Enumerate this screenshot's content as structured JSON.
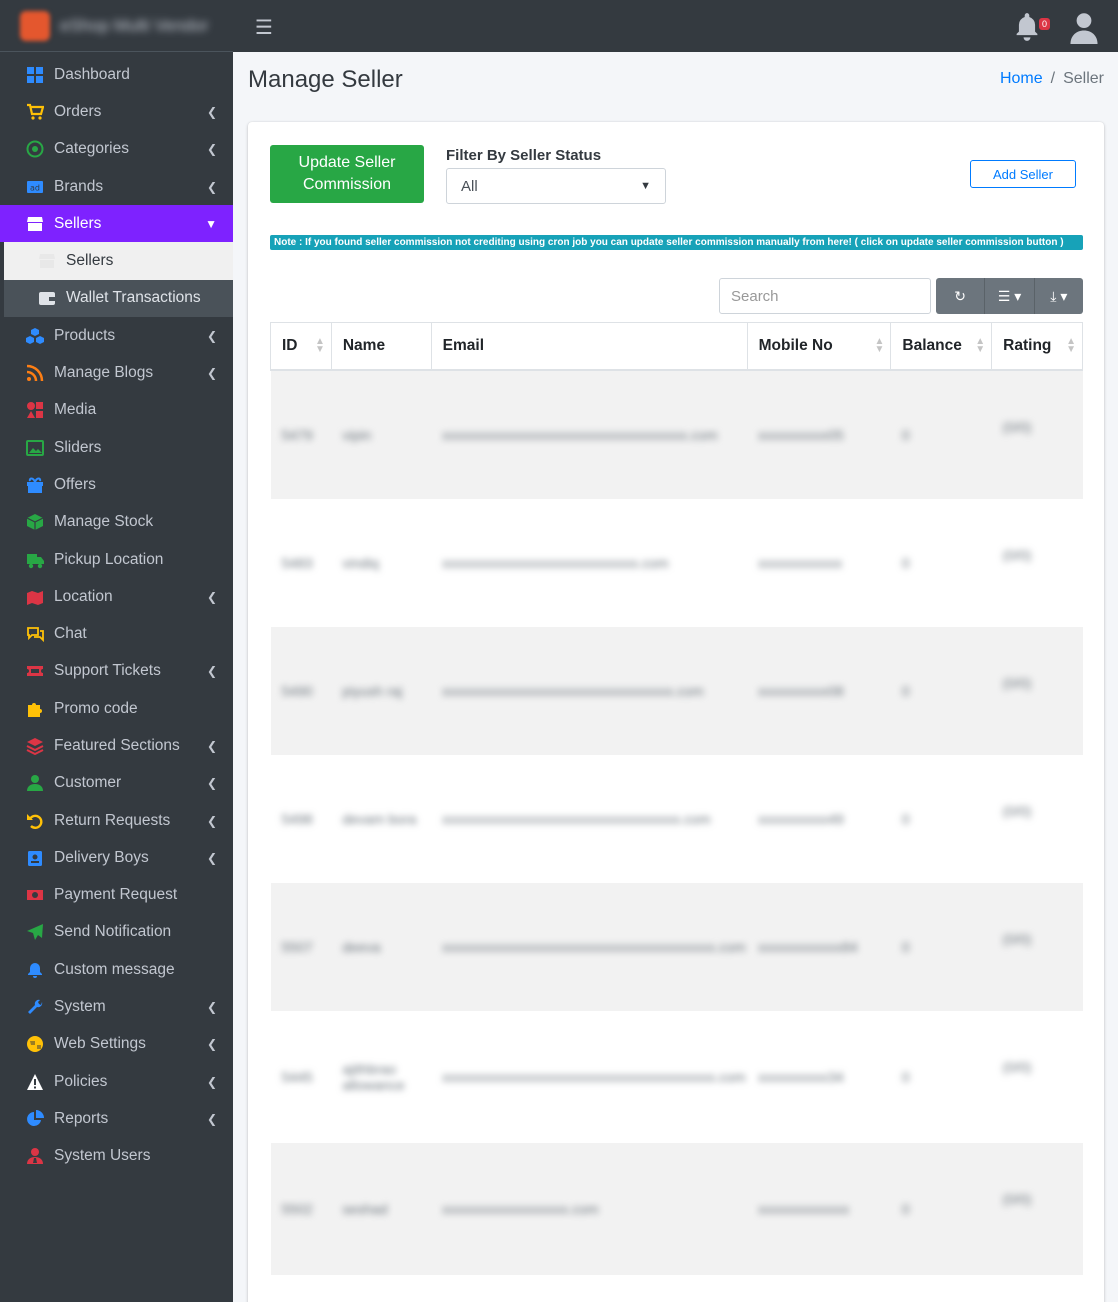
{
  "app": {
    "brand_name": "eShop Multi Vendor"
  },
  "sidebar": {
    "items": [
      {
        "label": "Dashboard",
        "icon": "dashboard-icon",
        "color": "#2e8bff",
        "chevron": false
      },
      {
        "label": "Orders",
        "icon": "cart-icon",
        "color": "#ffc107",
        "chevron": true
      },
      {
        "label": "Categories",
        "icon": "target-icon",
        "color": "#28a745",
        "chevron": true
      },
      {
        "label": "Brands",
        "icon": "brands-icon",
        "color": "#2e8bff",
        "chevron": true
      },
      {
        "label": "Sellers",
        "icon": "store-icon",
        "color": "#ffffff",
        "chevron": true,
        "active": true
      },
      {
        "label": "Products",
        "icon": "cubes-icon",
        "color": "#2e8bff",
        "chevron": true
      },
      {
        "label": "Manage Blogs",
        "icon": "rss-icon",
        "color": "#fd7e14",
        "chevron": true
      },
      {
        "label": "Media",
        "icon": "shapes-icon",
        "color": "#dc3545",
        "chevron": false
      },
      {
        "label": "Sliders",
        "icon": "image-icon",
        "color": "#28a745",
        "chevron": false
      },
      {
        "label": "Offers",
        "icon": "gift-icon",
        "color": "#2e8bff",
        "chevron": false
      },
      {
        "label": "Manage Stock",
        "icon": "box-icon",
        "color": "#28a745",
        "chevron": false
      },
      {
        "label": "Pickup Location",
        "icon": "truck-icon",
        "color": "#28a745",
        "chevron": false
      },
      {
        "label": "Location",
        "icon": "map-icon",
        "color": "#dc3545",
        "chevron": true
      },
      {
        "label": "Chat",
        "icon": "chat-icon",
        "color": "#ffc107",
        "chevron": false
      },
      {
        "label": "Support Tickets",
        "icon": "ticket-icon",
        "color": "#dc3545",
        "chevron": true
      },
      {
        "label": "Promo code",
        "icon": "puzzle-icon",
        "color": "#ffc107",
        "chevron": false
      },
      {
        "label": "Featured Sections",
        "icon": "layers-icon",
        "color": "#dc3545",
        "chevron": true
      },
      {
        "label": "Customer",
        "icon": "user-icon",
        "color": "#28a745",
        "chevron": true
      },
      {
        "label": "Return Requests",
        "icon": "undo-icon",
        "color": "#ffc107",
        "chevron": true
      },
      {
        "label": "Delivery Boys",
        "icon": "id-badge-icon",
        "color": "#2e8bff",
        "chevron": true
      },
      {
        "label": "Payment Request",
        "icon": "money-icon",
        "color": "#dc3545",
        "chevron": false
      },
      {
        "label": "Send Notification",
        "icon": "paper-plane-icon",
        "color": "#28a745",
        "chevron": false
      },
      {
        "label": "Custom message",
        "icon": "bell-icon",
        "color": "#2e8bff",
        "chevron": false
      },
      {
        "label": "System",
        "icon": "wrench-icon",
        "color": "#2e8bff",
        "chevron": true
      },
      {
        "label": "Web Settings",
        "icon": "globe-icon",
        "color": "#ffc107",
        "chevron": true
      },
      {
        "label": "Policies",
        "icon": "warning-icon",
        "color": "#ffffff",
        "chevron": true
      },
      {
        "label": "Reports",
        "icon": "pie-chart-icon",
        "color": "#2e8bff",
        "chevron": true
      },
      {
        "label": "System Users",
        "icon": "user-tie-icon",
        "color": "#dc3545",
        "chevron": false
      }
    ],
    "sellers_submenu": [
      {
        "label": "Sellers",
        "icon": "store-icon"
      },
      {
        "label": "Wallet Transactions",
        "icon": "wallet-icon"
      }
    ]
  },
  "topbar": {
    "notification_count": "0"
  },
  "page": {
    "title": "Manage Seller",
    "breadcrumb": {
      "home": "Home",
      "current": "Seller"
    },
    "commission_button_line1": "Update Seller",
    "commission_button_line2": "Commission",
    "filter_label": "Filter By Seller Status",
    "filter_value": "All",
    "add_button": "Add Seller",
    "note": "Note : If you found seller commission not crediting using cron job you can update seller commission manually from here! ( click on update seller commission button )",
    "search_placeholder": "Search"
  },
  "table": {
    "columns": [
      "ID",
      "Name",
      "Email",
      "Mobile No",
      "Balance",
      "Rating"
    ],
    "rows": [
      {
        "id": "5479",
        "name": "vipin",
        "email": "xxxxxxxxxxxxxxxxxxxxxxxxxxxxxxxxxxx.com",
        "mobile": "xxxxxxxxxx05",
        "balance": "0",
        "rating": "(0/0)"
      },
      {
        "id": "5483",
        "name": "vindiq",
        "email": "xxxxxxxxxxxxxxxxxxxxxxxxxxxx.com",
        "mobile": "xxxxxxxxxxxx",
        "balance": "0",
        "rating": "(0/0)"
      },
      {
        "id": "5490",
        "name": "piyush raj",
        "email": "xxxxxxxxxxxxxxxxxxxxxxxxxxxxxxxxx.com",
        "mobile": "xxxxxxxxxx08",
        "balance": "0",
        "rating": "(0/0)"
      },
      {
        "id": "5498",
        "name": "devam bora",
        "email": "xxxxxxxxxxxxxxxxxxxxxxxxxxxxxxxxxx.com",
        "mobile": "xxxxxxxxxx49",
        "balance": "0",
        "rating": "(0/0)"
      },
      {
        "id": "5507",
        "name": "deeva",
        "email": "xxxxxxxxxxxxxxxxxxxxxxxxxxxxxxxxxxxxxxx.com",
        "mobile": "xxxxxxxxxxxx84",
        "balance": "0",
        "rating": "(0/0)"
      },
      {
        "id": "5445",
        "name": "ajithbrao allowance",
        "email": "xxxxxxxxxxxxxxxxxxxxxxxxxxxxxxxxxxxxxxx.com",
        "mobile": "xxxxxxxxxx34",
        "balance": "0",
        "rating": "(0/0)"
      },
      {
        "id": "5502",
        "name": "seshad",
        "email": "xxxxxxxxxxxxxxxxxx.com",
        "mobile": "xxxxxxxxxxxxx",
        "balance": "0",
        "rating": "(0/0)"
      }
    ]
  }
}
